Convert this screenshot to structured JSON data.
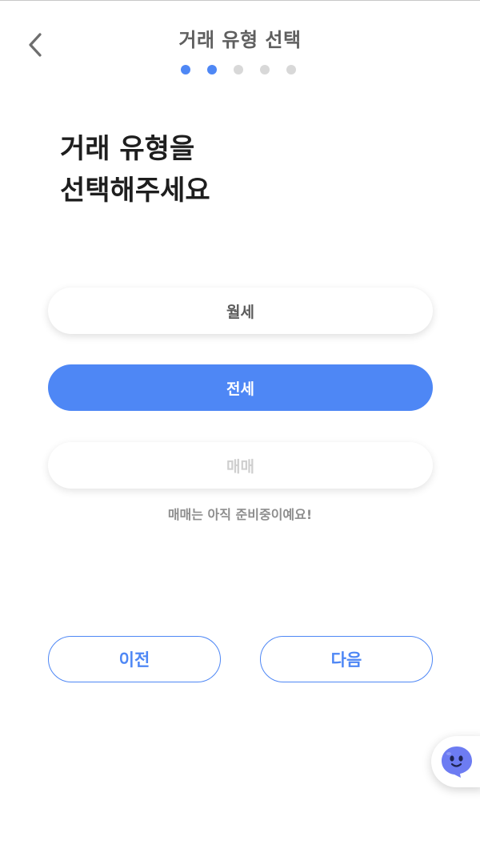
{
  "header": {
    "title": "거래 유형 선택",
    "back_icon": "chevron-left-icon",
    "progress": {
      "total_steps": 5,
      "current_step": 2
    }
  },
  "main": {
    "heading_line1": "거래 유형을",
    "heading_line2": "선택해주세요"
  },
  "options": {
    "monthly_label": "월세",
    "jeonse_label": "전세",
    "sale_label": "매매",
    "selected": "전세",
    "sale_notice": "매매는 아직 준비중이예요!"
  },
  "footer": {
    "prev_label": "이전",
    "next_label": "다음"
  },
  "chatbot": {
    "icon": "ghost-chat-icon"
  },
  "colors": {
    "accent": "#4e87f5",
    "dot_inactive": "#d8d8d8",
    "title_text": "#5f5f5f",
    "heading_text": "#1e1e1e",
    "disabled_text": "#cfcfcf",
    "notice_text": "#8e8e8e",
    "chatbot_face": "#6d7cf2"
  }
}
